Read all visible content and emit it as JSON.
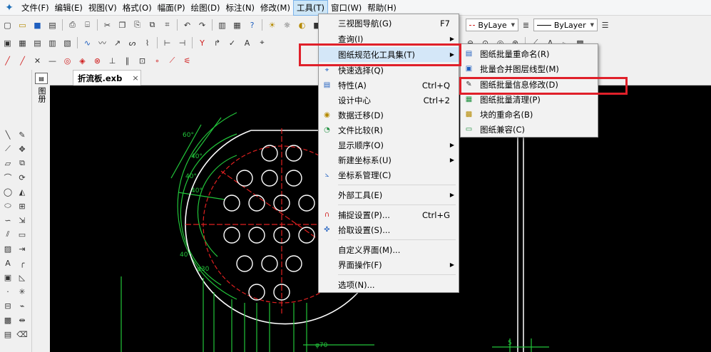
{
  "menubar": {
    "items": [
      "文件(F)",
      "编辑(E)",
      "视图(V)",
      "格式(O)",
      "幅面(P)",
      "绘图(D)",
      "标注(N)",
      "修改(M)",
      "工具(T)",
      "窗口(W)",
      "帮助(H)"
    ]
  },
  "toolbar": {
    "layer_combo_1": "ByLaye",
    "layer_combo_2": "ByLayer"
  },
  "document": {
    "tab_title": "折流板.exb",
    "tab_close": "×"
  },
  "side_panel": {
    "vertical_label": "图册"
  },
  "tools_menu": {
    "items": [
      {
        "label": "三视图导航(G)",
        "shortcut": "F7",
        "submenu": false
      },
      {
        "label": "查询(I)",
        "shortcut": "",
        "submenu": true
      },
      {
        "label": "图纸规范化工具集(T)",
        "shortcut": "",
        "submenu": true
      },
      {
        "label": "快速选择(Q)",
        "shortcut": "",
        "submenu": false
      },
      {
        "label": "特性(A)",
        "shortcut": "Ctrl+Q",
        "submenu": false
      },
      {
        "label": "设计中心",
        "shortcut": "Ctrl+2",
        "submenu": false
      },
      {
        "label": "数据迁移(D)",
        "shortcut": "",
        "submenu": false
      },
      {
        "label": "文件比较(R)",
        "shortcut": "",
        "submenu": false
      },
      {
        "label": "显示顺序(O)",
        "shortcut": "",
        "submenu": true
      },
      {
        "label": "新建坐标系(U)",
        "shortcut": "",
        "submenu": true
      },
      {
        "label": "坐标系管理(C)",
        "shortcut": "",
        "submenu": false
      },
      {
        "label": "外部工具(E)",
        "shortcut": "",
        "submenu": true
      },
      {
        "label": "捕捉设置(P)...",
        "shortcut": "Ctrl+G",
        "submenu": false
      },
      {
        "label": "拾取设置(S)...",
        "shortcut": "",
        "submenu": false
      },
      {
        "label": "自定义界面(M)...",
        "shortcut": "",
        "submenu": false
      },
      {
        "label": "界面操作(F)",
        "shortcut": "",
        "submenu": true
      },
      {
        "label": "选项(N)...",
        "shortcut": "",
        "submenu": false
      }
    ]
  },
  "sub_menu": {
    "items": [
      "图纸批量重命名(R)",
      "批量合并图层线型(M)",
      "图纸批量信息修改(D)",
      "图纸批量清理(P)",
      "块的重命名(B)",
      "图纸兼容(C)"
    ]
  },
  "drawing_labels": {
    "angles": [
      "60°",
      "40°",
      "40°",
      "40°",
      "40°"
    ],
    "diameter": "φ30",
    "bottom_dim": "φ70",
    "right_dim": "5"
  },
  "colors": {
    "canvas_bg": "#000000",
    "drawing_green": "#22c43a",
    "drawing_red": "#e02020",
    "drawing_white": "#ffffff",
    "menu_highlight": "#d4e7f8",
    "annotation_red": "#e0202a"
  }
}
